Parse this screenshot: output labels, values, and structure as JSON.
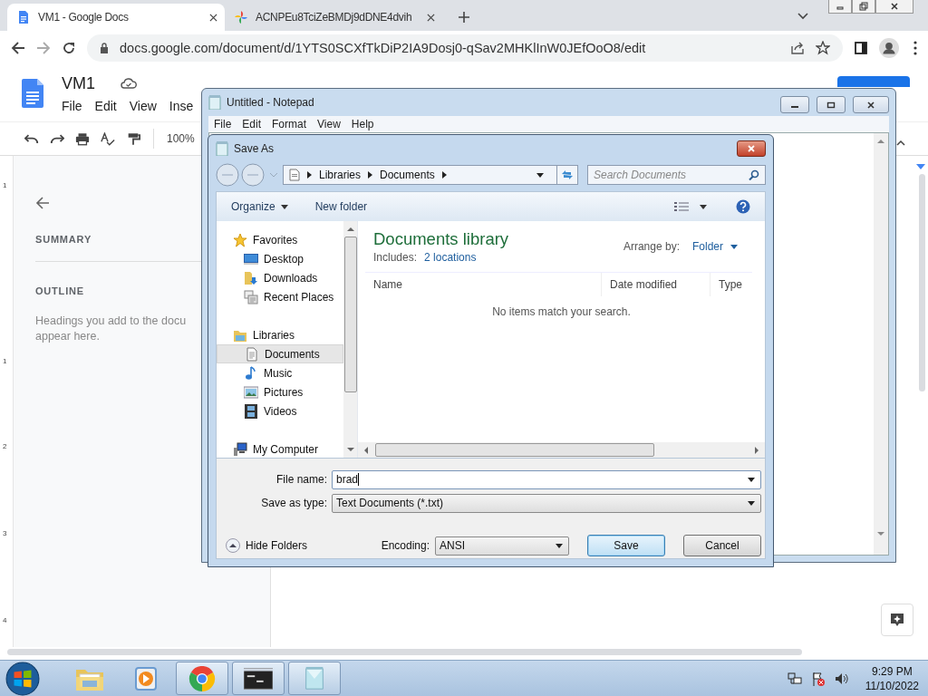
{
  "browser": {
    "tabs": [
      {
        "title": "VM1 - Google Docs",
        "kind": "docs",
        "selected": true
      },
      {
        "title": "ACNPEu8TciZeBMDj9dDNE4dvih",
        "kind": "photos",
        "selected": false
      }
    ],
    "url": "docs.google.com/document/d/1YTS0SCXfTkDiP2IA9Dosj0-qSav2MHKlInW0JEfOoO8/edit"
  },
  "docs": {
    "title": "VM1",
    "menu": [
      "File",
      "Edit",
      "View",
      "Inse"
    ],
    "zoom": "100%",
    "summary": "SUMMARY",
    "outline": "OUTLINE",
    "hint": [
      "Headings you add to the docu",
      "appear here."
    ],
    "ruler": [
      "1",
      "1",
      "2",
      "3",
      "4"
    ]
  },
  "notepad": {
    "title": "Untitled - Notepad",
    "menu": [
      "File",
      "Edit",
      "Format",
      "View",
      "Help"
    ]
  },
  "save_as": {
    "title": "Save As",
    "breadcrumb": [
      "Libraries",
      "Documents"
    ],
    "search": {
      "placeholder": "Search Documents"
    },
    "toolbar": [
      "Organize",
      "New folder"
    ],
    "tree": [
      {
        "label": "Favorites",
        "kind": "star",
        "selected": false,
        "children": [
          {
            "label": "Desktop",
            "kind": "desktop",
            "selected": false
          },
          {
            "label": "Downloads",
            "kind": "downloads",
            "selected": false
          },
          {
            "label": "Recent Places",
            "kind": "recent",
            "selected": false
          }
        ]
      },
      {
        "label": "Libraries",
        "kind": "library",
        "selected": false,
        "children": [
          {
            "label": "Documents",
            "kind": "document",
            "selected": true
          },
          {
            "label": "Music",
            "kind": "music",
            "selected": false
          },
          {
            "label": "Pictures",
            "kind": "pictures",
            "selected": false
          },
          {
            "label": "Videos",
            "kind": "videos",
            "selected": false
          }
        ]
      },
      {
        "label": "My Computer",
        "kind": "computer",
        "selected": false
      }
    ],
    "heading": "Documents library",
    "includes": "Includes:",
    "locations": "2 locations",
    "arrange_label": "Arrange by:",
    "arrange_value": "Folder",
    "columns": [
      "Name",
      "Date modified",
      "Type"
    ],
    "empty": "No items match your search.",
    "file_name": {
      "label": "File name:",
      "value": "brad"
    },
    "save_type": {
      "label": "Save as type:",
      "value": "Text Documents (*.txt)"
    },
    "hide_folders": "Hide Folders",
    "encoding": {
      "label": "Encoding:",
      "value": "ANSI"
    },
    "buttons": [
      {
        "label": "Save",
        "default": true
      },
      {
        "label": "Cancel",
        "default": false
      }
    ]
  },
  "taskbar": {
    "apps": [
      {
        "kind": "explorer",
        "running": false
      },
      {
        "kind": "media",
        "running": false
      },
      {
        "kind": "chrome",
        "running": true
      },
      {
        "kind": "cmd",
        "running": true
      },
      {
        "kind": "notepad",
        "running": true
      }
    ],
    "time": "9:29 PM",
    "date": "11/10/2022"
  }
}
